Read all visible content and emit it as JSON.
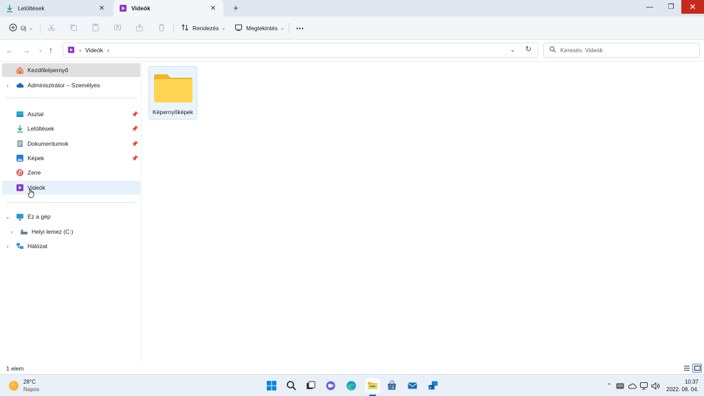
{
  "tabs": [
    {
      "label": "Letöltések",
      "icon": "download-icon",
      "close": "✕"
    },
    {
      "label": "Videók",
      "icon": "videos-icon",
      "close": "✕"
    }
  ],
  "window": {
    "new_tab": "+",
    "minimize": "—",
    "maximize": "❐",
    "close": "✕"
  },
  "toolbar": {
    "new_label": "Új",
    "sort_label": "Rendezés",
    "view_label": "Megtekintés",
    "more_label": "•••"
  },
  "address": {
    "crumbs": [
      "Videók"
    ],
    "search_placeholder": "Keresés: Videók"
  },
  "sidebar": {
    "items": [
      {
        "label": "Kezdőképernyő",
        "icon": "home-icon"
      },
      {
        "label": "Adminisztrátor – Személyes",
        "icon": "onedrive-cloud-icon"
      },
      {
        "label": "Asztal",
        "icon": "desktop-icon"
      },
      {
        "label": "Letöltések",
        "icon": "download-icon"
      },
      {
        "label": "Dokumentumok",
        "icon": "documents-icon"
      },
      {
        "label": "Képek",
        "icon": "pictures-icon"
      },
      {
        "label": "Zene",
        "icon": "music-icon"
      },
      {
        "label": "Videók",
        "icon": "videos-icon"
      },
      {
        "label": "Ez a gép",
        "icon": "this-pc-icon"
      },
      {
        "label": "Helyi lemez (C:)",
        "icon": "drive-icon"
      },
      {
        "label": "Hálózat",
        "icon": "network-icon"
      }
    ]
  },
  "content": {
    "items": [
      {
        "name": "Képernyőképek",
        "icon": "folder-icon"
      }
    ]
  },
  "status": {
    "count": "1 elem"
  },
  "taskbar": {
    "weather_temp": "28°C",
    "weather_cond": "Napos",
    "time": "10:37",
    "date": "2022. 08. 04."
  },
  "colors": {
    "accent": "#0067c0",
    "close_red": "#c42b1c",
    "folder_yellow": "#ffd452",
    "videos_purple": "#8a3ac9"
  }
}
